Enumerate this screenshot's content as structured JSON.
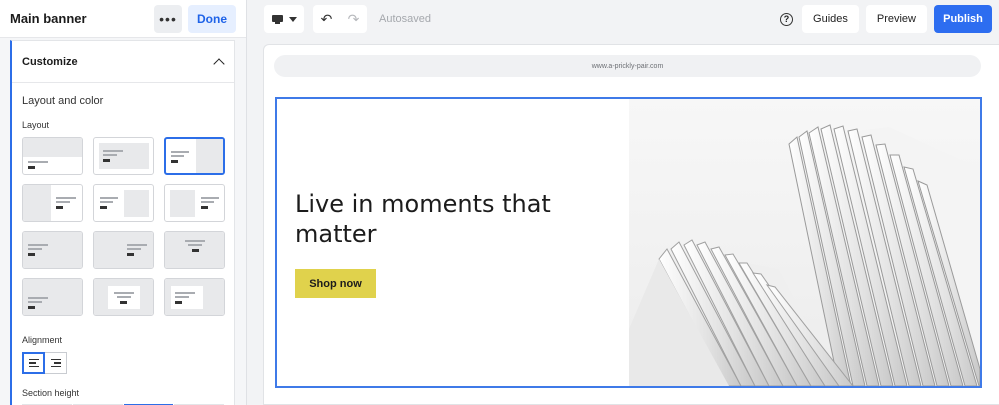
{
  "panel": {
    "title": "Main banner",
    "more_icon": "more-horizontal-icon",
    "done_label": "Done",
    "customize_label": "Customize",
    "layout_and_color_label": "Layout and color",
    "layout_label": "Layout",
    "alignment_label": "Alignment",
    "section_height_label": "Section height",
    "selected_layout_index": 2,
    "selected_alignment": "left",
    "section_height_selected_segment": 3
  },
  "toolbar": {
    "device_icon": "desktop-monitor-icon",
    "undo_icon": "undo-icon",
    "redo_icon": "redo-icon",
    "autosaved_label": "Autosaved",
    "help_icon": "help-circle-icon",
    "guides_label": "Guides",
    "preview_label": "Preview",
    "publish_label": "Publish"
  },
  "canvas": {
    "url": "www.a-prickly-pair.com",
    "headline": "Live in moments that matter",
    "cta_label": "Shop now"
  },
  "colors": {
    "accent": "#2d6df0",
    "cta": "#e0d24c"
  }
}
